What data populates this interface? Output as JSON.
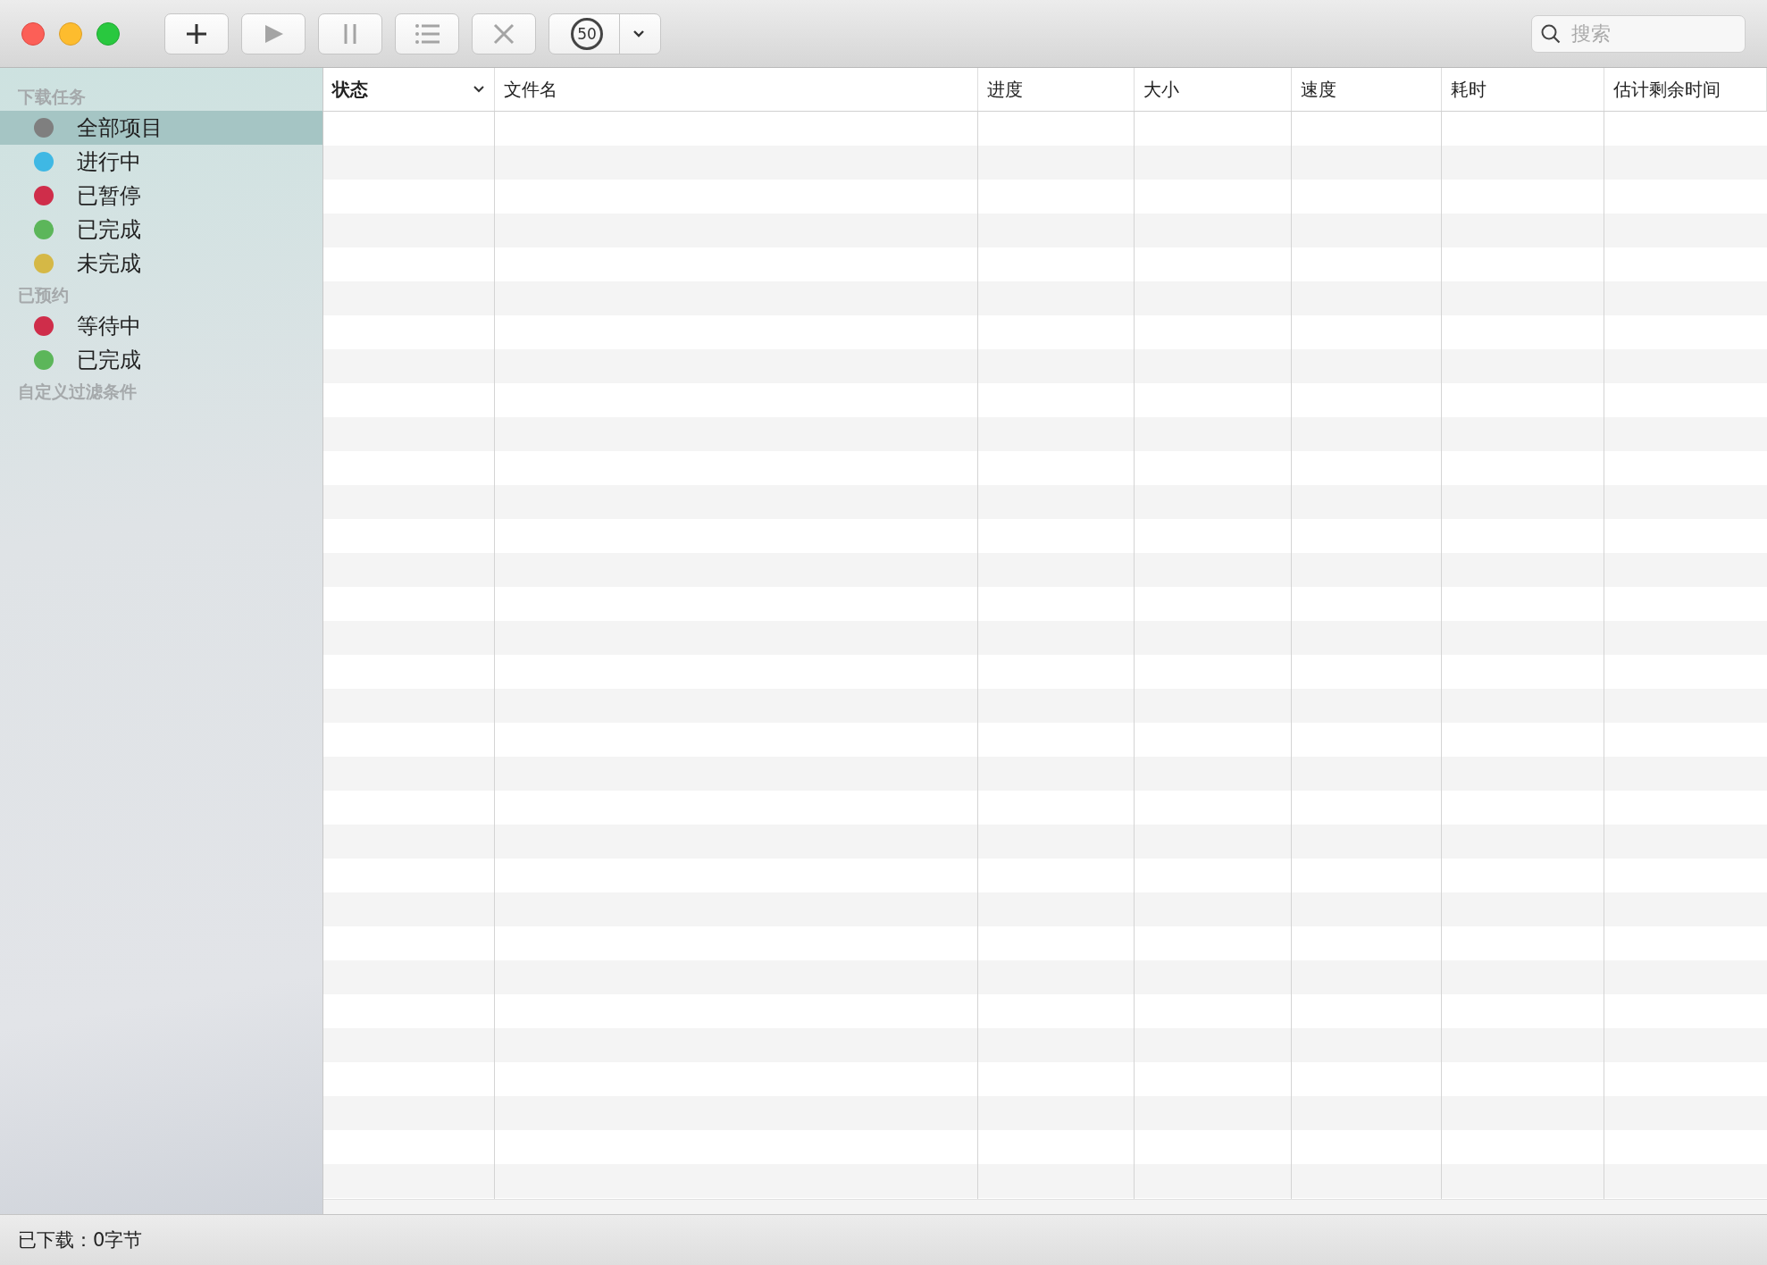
{
  "toolbar": {
    "buttons": [
      {
        "kind": "add",
        "disabled": false
      },
      {
        "kind": "play",
        "disabled": true
      },
      {
        "kind": "pause",
        "disabled": true
      },
      {
        "kind": "list",
        "disabled": true
      },
      {
        "kind": "remove",
        "disabled": true
      }
    ],
    "speed_limit": {
      "label": "50"
    },
    "search": {
      "placeholder": "搜索"
    }
  },
  "sidebar": {
    "sections": [
      {
        "title": "下载任务",
        "items": [
          {
            "label": "全部项目",
            "color": "#7f7f7f",
            "selected": true
          },
          {
            "label": "进行中",
            "color": "#3fb8e4",
            "selected": false
          },
          {
            "label": "已暂停",
            "color": "#cf2d4a",
            "selected": false
          },
          {
            "label": "已完成",
            "color": "#5cb65a",
            "selected": false
          },
          {
            "label": "未完成",
            "color": "#d5b846",
            "selected": false
          }
        ]
      },
      {
        "title": "已预约",
        "items": [
          {
            "label": "等待中",
            "color": "#cf2d4a",
            "selected": false
          },
          {
            "label": "已完成",
            "color": "#5cb65a",
            "selected": false
          }
        ]
      },
      {
        "title": "自定义过滤条件"
      }
    ]
  },
  "table": {
    "columns": [
      {
        "label": "状态",
        "sortable": true
      },
      {
        "label": "文件名",
        "sortable": false
      },
      {
        "label": "进度",
        "sortable": false
      },
      {
        "label": "大小",
        "sortable": false
      },
      {
        "label": "速度",
        "sortable": false
      },
      {
        "label": "耗时",
        "sortable": false
      },
      {
        "label": "估计剩余时间",
        "sortable": false
      }
    ]
  },
  "status_bar": {
    "text": "已下载：0字节"
  }
}
